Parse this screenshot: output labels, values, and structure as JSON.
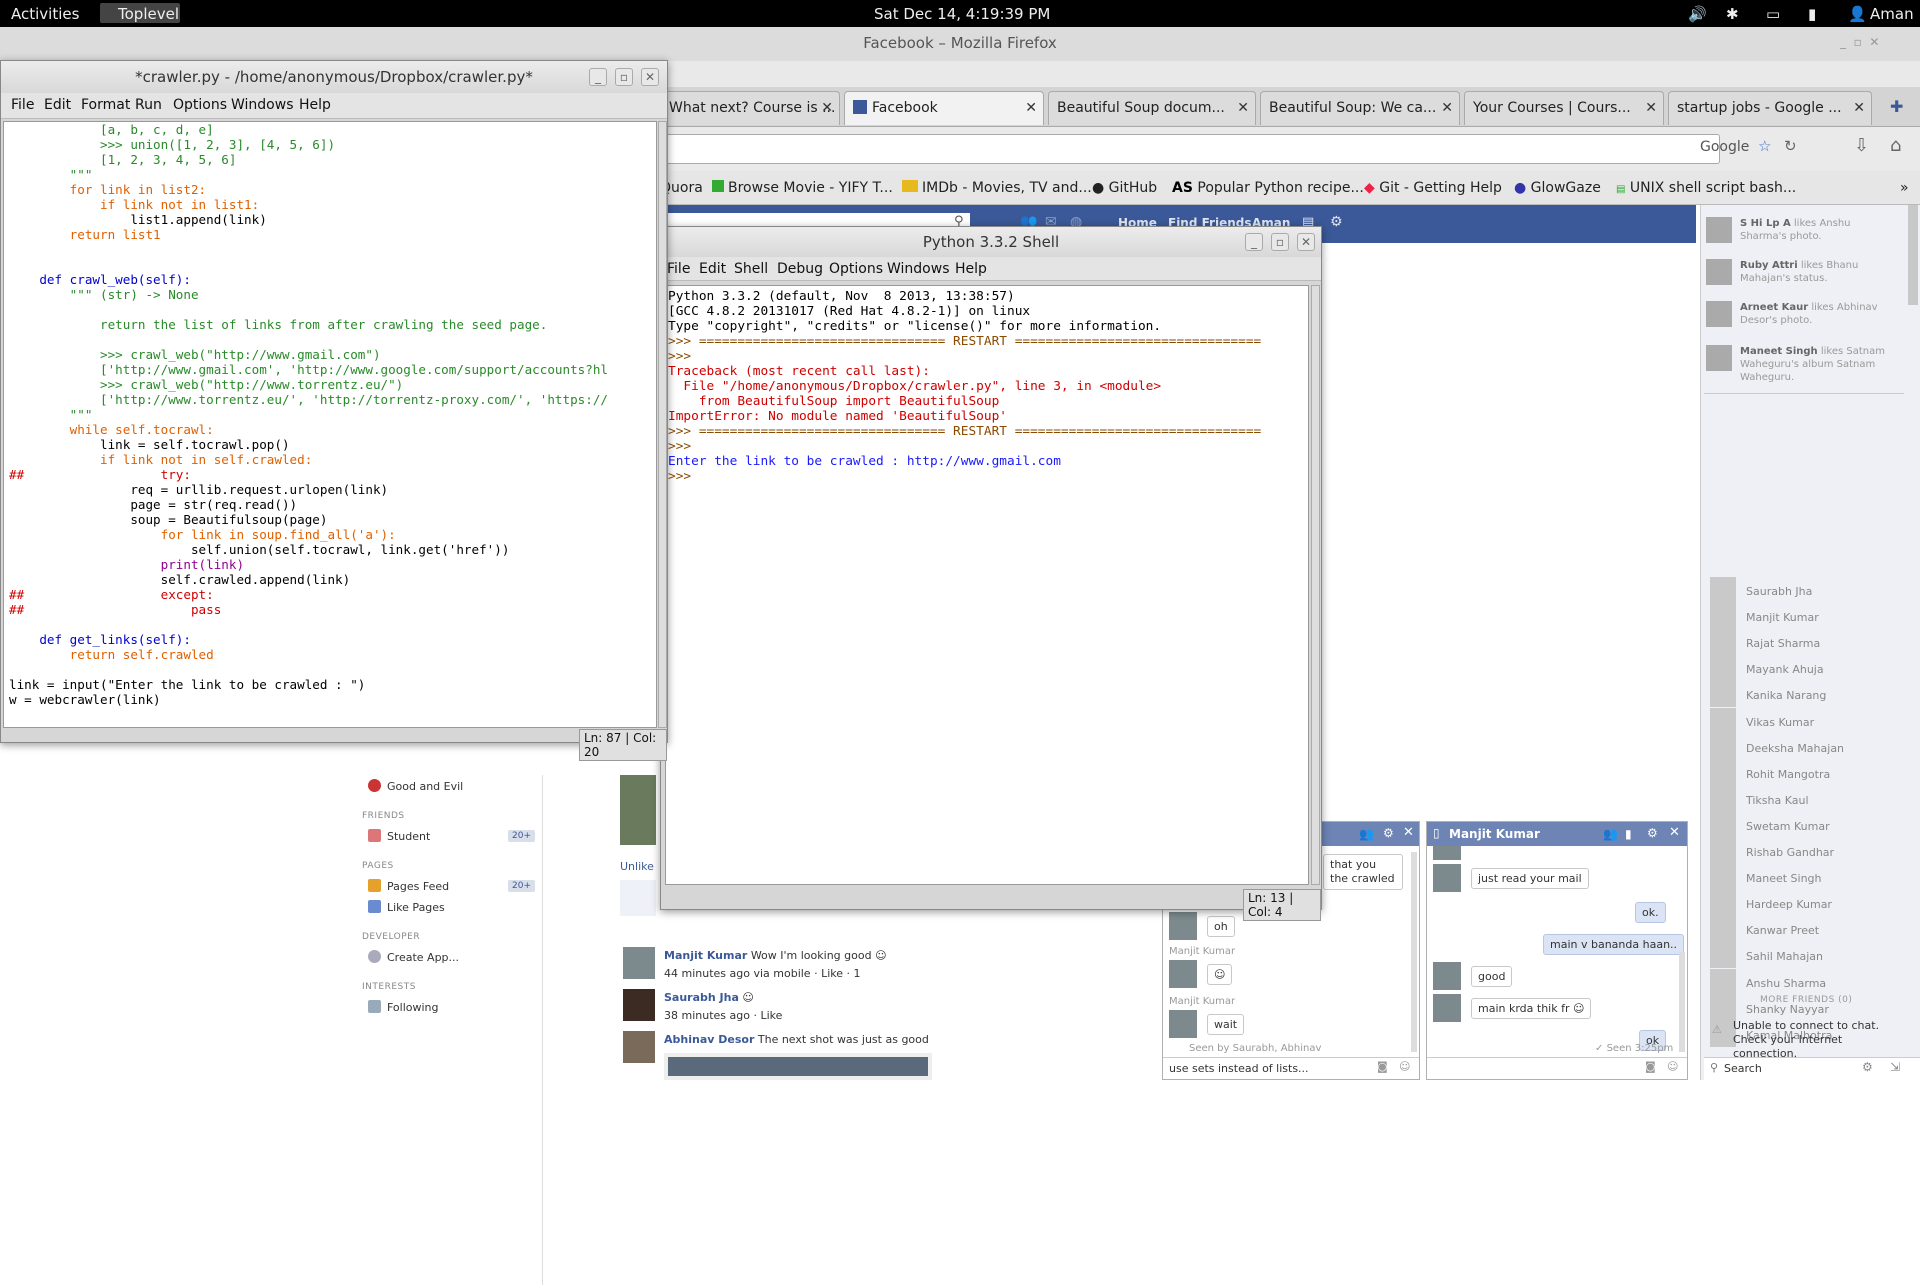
{
  "topbar": {
    "activities": "Activities",
    "app": "Toplevel",
    "clock": "Sat Dec 14,  4:19:39 PM",
    "user": "Aman"
  },
  "firefox": {
    "title": "Facebook – Mozilla Firefox",
    "tabs": [
      {
        "label": "What next? Course is ..."
      },
      {
        "label": "Facebook"
      },
      {
        "label": "Beautiful Soup docum..."
      },
      {
        "label": "Beautiful Soup: We ca..."
      },
      {
        "label": "Your Courses | Cours..."
      },
      {
        "label": "startup jobs - Google ..."
      }
    ],
    "search_engine": "Google",
    "bookmarks": [
      "Quora",
      "Browse Movie - YIFY T...",
      "IMDb - Movies, TV and...",
      "GitHub",
      "Popular Python recipe...",
      "Git - Getting Help",
      "GlowGaze",
      "UNIX shell script bash..."
    ]
  },
  "facebook": {
    "nav": {
      "home": "Home",
      "find_friends": "Find Friends",
      "user": "Aman"
    },
    "left": {
      "good_and_evil": "Good and Evil",
      "friends_header": "FRIENDS",
      "student": "Student",
      "student_badge": "20+",
      "pages_header": "PAGES",
      "pages_feed": "Pages Feed",
      "pages_badge": "20+",
      "like_pages": "Like Pages",
      "developer_header": "DEVELOPER",
      "create_app": "Create App...",
      "interests_header": "INTERESTS",
      "following": "Following"
    },
    "feed": {
      "unlike": "Unlike",
      "posts": [
        {
          "author": "Manjit Kumar",
          "text": "Wow I'm looking good",
          "meta": "44 minutes ago via mobile · Like · 1"
        },
        {
          "author": "Saurabh Jha",
          "text": "",
          "meta": "38 minutes ago · Like"
        },
        {
          "author": "Abhinav Desor",
          "text": "The next shot was just as good",
          "meta": ""
        }
      ]
    },
    "ticker": [
      {
        "name": "S Hi Lp A",
        "text": "likes Anshu Sharma's photo."
      },
      {
        "name": "Ruby Attri",
        "text": "likes Bhanu Mahajan's status."
      },
      {
        "name": "Arneet Kaur",
        "text": "likes Abhinav Desor's photo."
      },
      {
        "name": "Maneet Singh",
        "text": "likes Satnam Waheguru's album Satnam Waheguru."
      }
    ],
    "friends": [
      "Saurabh Jha",
      "Manjit Kumar",
      "Rajat Sharma",
      "Mayank Ahuja",
      "Kanika Narang",
      "Vikas Kumar",
      "Deeksha Mahajan",
      "Rohit Mangotra",
      "Tiksha Kaul",
      "Swetam Kumar",
      "Rishab Gandhar",
      "Maneet Singh",
      "Hardeep Kumar",
      "Kanwar Preet",
      "Sahil Mahajan",
      "Anshu Sharma",
      "Shanky Nayyar",
      "Kamal Malhotra"
    ],
    "more_friends": "MORE FRIENDS (0)",
    "chat_error": "Unable to connect to chat. Check your Internet connection.",
    "search": "Search",
    "chat1": {
      "name": "Manjit Kumar",
      "msg_top": "that you the crawled",
      "msg_oh": "oh",
      "label1": "Manjit Kumar",
      "label2": "Manjit Kumar",
      "msg_wait": "wait",
      "seen": "Seen by Saurabh, Abhinav",
      "input": "use sets instead of lists..."
    },
    "chat2": {
      "name": "Manjit Kumar",
      "msgs": [
        "just read your mail",
        "ok.",
        "main v bananda haan..",
        "good",
        "main krda thik fr",
        "ok"
      ],
      "seen": "Seen 3:25pm"
    }
  },
  "editor": {
    "title": "*crawler.py - /home/anonymous/Dropbox/crawler.py*",
    "menu": [
      "File",
      "Edit",
      "Format",
      "Run",
      "Options",
      "Windows",
      "Help"
    ],
    "status_ln": "Ln: 87",
    "status_col": "Col: 20"
  },
  "shell": {
    "title": "Python 3.3.2 Shell",
    "menu": [
      "File",
      "Edit",
      "Shell",
      "Debug",
      "Options",
      "Windows",
      "Help"
    ],
    "lines": [
      "Python 3.3.2 (default, Nov  8 2013, 13:38:57)",
      "[GCC 4.8.2 20131017 (Red Hat 4.8.2-1)] on linux",
      "Type \"copyright\", \"credits\" or \"license()\" for more information.",
      ">>> ================================ RESTART ================================",
      ">>>",
      "Traceback (most recent call last):",
      "  File \"/home/anonymous/Dropbox/crawler.py\", line 3, in <module>",
      "    from BeautifulSoup import BeautifulSoup",
      "ImportError: No module named 'BeautifulSoup'",
      ">>> ================================ RESTART ================================",
      ">>>",
      "Enter the link to be crawled : http://www.gmail.com",
      ">>>"
    ],
    "status_ln": "Ln: 13",
    "status_col": "Col: 4"
  },
  "code_lines": [
    {
      "t": "            [a, b, c, d, e]",
      "c": "st"
    },
    {
      "t": "            >>> union([1, 2, 3], [4, 5, 6])",
      "c": "st"
    },
    {
      "t": "            [1, 2, 3, 4, 5, 6]",
      "c": "st"
    },
    {
      "t": "        \"\"\"",
      "c": "st"
    },
    {
      "t": "        for link in list2:",
      "c": "kw"
    },
    {
      "t": "            if link not in list1:",
      "c": "kw"
    },
    {
      "t": "                list1.append(link)",
      "c": ""
    },
    {
      "t": "        return list1",
      "c": "kw"
    },
    {
      "t": "",
      "c": ""
    },
    {
      "t": "",
      "c": ""
    },
    {
      "t": "    def crawl_web(self):",
      "c": "fn"
    },
    {
      "t": "        \"\"\" (str) -> None",
      "c": "st"
    },
    {
      "t": "",
      "c": ""
    },
    {
      "t": "            return the list of links from after crawling the seed page.",
      "c": "st"
    },
    {
      "t": "",
      "c": ""
    },
    {
      "t": "            >>> crawl_web(\"http://www.gmail.com\")",
      "c": "st"
    },
    {
      "t": "            ['http://www.gmail.com', 'http://www.google.com/support/accounts?hl",
      "c": "st"
    },
    {
      "t": "            >>> crawl_web(\"http://www.torrentz.eu/\")",
      "c": "st"
    },
    {
      "t": "            ['http://www.torrentz.eu/', 'http://torrentz-proxy.com/', 'https://",
      "c": "st"
    },
    {
      "t": "        \"\"\"",
      "c": "st"
    },
    {
      "t": "        while self.tocrawl:",
      "c": "kw"
    },
    {
      "t": "            link = self.tocrawl.pop()",
      "c": ""
    },
    {
      "t": "            if link not in self.crawled:",
      "c": "kw"
    },
    {
      "t": "##                  try:",
      "c": "cm"
    },
    {
      "t": "                req = urllib.request.urlopen(link)",
      "c": ""
    },
    {
      "t": "                page = str(req.read())",
      "c": ""
    },
    {
      "t": "                soup = Beautifulsoup(page)",
      "c": ""
    },
    {
      "t": "                    for link in soup.find_all('a'):",
      "c": "kw"
    },
    {
      "t": "                        self.union(self.tocrawl, link.get('href'))",
      "c": ""
    },
    {
      "t": "                    print(link)",
      "c": "bi"
    },
    {
      "t": "                    self.crawled.append(link)",
      "c": ""
    },
    {
      "t": "##                  except:",
      "c": "cm"
    },
    {
      "t": "##                      pass",
      "c": "cm"
    },
    {
      "t": "",
      "c": ""
    },
    {
      "t": "    def get_links(self):",
      "c": "fn"
    },
    {
      "t": "        return self.crawled",
      "c": "kw"
    },
    {
      "t": "",
      "c": ""
    },
    {
      "t": "link = input(\"Enter the link to be crawled : \")",
      "c": ""
    },
    {
      "t": "w = webcrawler(link)",
      "c": ""
    }
  ]
}
